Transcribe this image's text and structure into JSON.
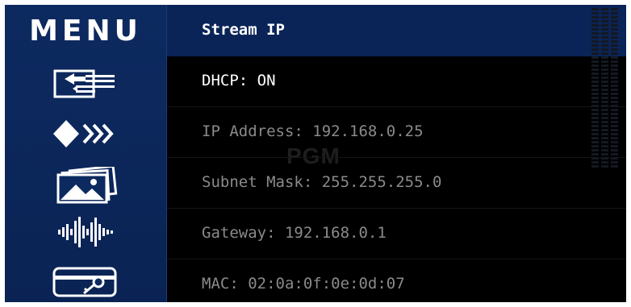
{
  "sidebar": {
    "title": "MENU",
    "icons": [
      "input-output-icon",
      "transition-icon",
      "media-icon",
      "audio-icon",
      "key-icon"
    ]
  },
  "header": {
    "title": "Stream IP"
  },
  "rows": [
    {
      "label": "DHCP: ON",
      "state": "active"
    },
    {
      "label": "IP Address: 192.168.0.25",
      "state": "dim"
    },
    {
      "label": "Subnet Mask: 255.255.255.0",
      "state": "dim"
    },
    {
      "label": "Gateway: 192.168.0.1",
      "state": "dim"
    },
    {
      "label": "MAC: 02:0a:0f:0e:0d:07",
      "state": "dim"
    }
  ],
  "watermark": "PGM",
  "colors": {
    "sidebar_bg": "#0d2a60",
    "header_bg": "#0b2458",
    "screen_bg": "#000000",
    "active_text": "#ffffff",
    "dim_text": "#8a8a8a"
  }
}
